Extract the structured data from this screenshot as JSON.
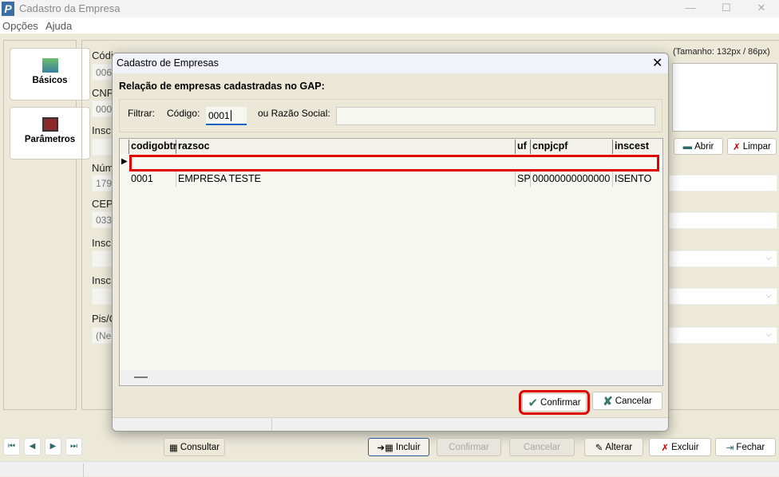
{
  "window": {
    "title": "Cadastro da Empresa",
    "icon": "app-logo-p"
  },
  "menu": [
    "Opções",
    "Ajuda"
  ],
  "sidebar": [
    {
      "label": "Básicos",
      "icon": "form-icon"
    },
    {
      "label": "Parâmetros",
      "icon": "book-icon"
    }
  ],
  "form": {
    "labels": [
      "Códi",
      "CNP",
      "Insc",
      "Núm",
      "CEP",
      "Insc",
      "Insc",
      "Pis/C"
    ],
    "values": {
      "codigo": "006",
      "cnpj": "000",
      "numero": "179",
      "cep": "033",
      "pis": "(Ne"
    },
    "logo_size": "(Tamanho: 132px / 86px)",
    "abrir": "Abrir",
    "limpar": "Limpar"
  },
  "dialog": {
    "title": "Cadastro de Empresas",
    "heading": "Relação de empresas cadastradas no GAP:",
    "filter_label": "Filtrar:",
    "codigo_label": "Código:",
    "codigo_value": "0001",
    "razao_label": "ou Razão Social:",
    "razao_value": "",
    "columns": [
      "codigobtr",
      "razsoc",
      "uf",
      "cnpjcpf",
      "inscest"
    ],
    "rows": [
      [
        "0001",
        "EMPRESA TESTE",
        "SP",
        "00000000000000",
        "ISENTO"
      ]
    ],
    "confirm": "Confirmar",
    "cancel": "Cancelar",
    "highlight_color": "#e00000"
  },
  "toolbar": {
    "consultar": "Consultar",
    "incluir": "Incluir",
    "confirmar": "Confirmar",
    "cancelar": "Cancelar",
    "alterar": "Alterar",
    "excluir": "Excluir",
    "fechar": "Fechar"
  }
}
